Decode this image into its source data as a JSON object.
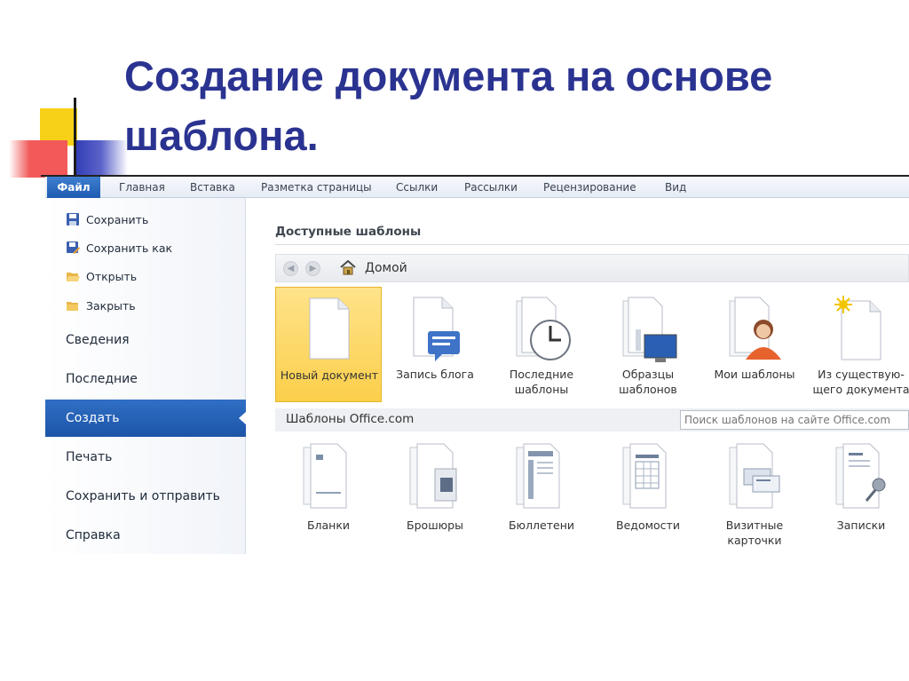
{
  "slide": {
    "title": "Создание документа на основе шаблона."
  },
  "ribbon": {
    "file_tab": "Файл",
    "tabs": [
      "Главная",
      "Вставка",
      "Разметка страницы",
      "Ссылки",
      "Рассылки",
      "Рецензирование",
      "Вид"
    ]
  },
  "backstage": {
    "commands": [
      {
        "label": "Сохранить",
        "icon": "save-icon"
      },
      {
        "label": "Сохранить как",
        "icon": "save-as-icon"
      },
      {
        "label": "Открыть",
        "icon": "open-folder-icon"
      },
      {
        "label": "Закрыть",
        "icon": "close-folder-icon"
      }
    ],
    "items": [
      {
        "label": "Сведения",
        "active": false
      },
      {
        "label": "Последние",
        "active": false
      },
      {
        "label": "Создать",
        "active": true
      },
      {
        "label": "Печать",
        "active": false
      },
      {
        "label": "Сохранить и отправить",
        "active": false
      },
      {
        "label": "Справка",
        "active": false
      }
    ]
  },
  "content": {
    "section_title": "Доступные шаблоны",
    "nav": {
      "back_icon": "back-arrow-icon",
      "forward_icon": "forward-arrow-icon",
      "home_icon": "home-icon",
      "home_label": "Домой"
    },
    "templates": [
      {
        "label": "Новый документ",
        "icon": "blank-document-icon",
        "selected": true
      },
      {
        "label": "Запись блога",
        "icon": "blog-post-icon",
        "selected": false
      },
      {
        "label": "Последние\nшаблоны",
        "icon": "recent-templates-icon",
        "selected": false
      },
      {
        "label": "Образцы\nшаблонов",
        "icon": "sample-templates-icon",
        "selected": false
      },
      {
        "label": "Мои шаблоны",
        "icon": "my-templates-icon",
        "selected": false
      },
      {
        "label": "Из существую-\nщего документа",
        "icon": "from-existing-icon",
        "selected": false
      }
    ],
    "office": {
      "label": "Шаблоны Office.com",
      "search_placeholder": "Поиск шаблонов на сайте Office.com"
    },
    "office_templates": [
      {
        "label": "Бланки",
        "icon": "forms-icon"
      },
      {
        "label": "Брошюры",
        "icon": "brochures-icon"
      },
      {
        "label": "Бюллетени",
        "icon": "newsletters-icon"
      },
      {
        "label": "Ведомости",
        "icon": "statements-icon"
      },
      {
        "label": "Визитные\nкарточки",
        "icon": "business-cards-icon"
      },
      {
        "label": "Записки",
        "icon": "memos-icon"
      }
    ]
  },
  "colors": {
    "title": "#2b3391",
    "active_nav": "#1d55a8",
    "selected_tile": "#fbcf4b",
    "deco_yellow": "#f7d117",
    "deco_red": "#f25a5a",
    "deco_blue": "#2f3db5"
  }
}
